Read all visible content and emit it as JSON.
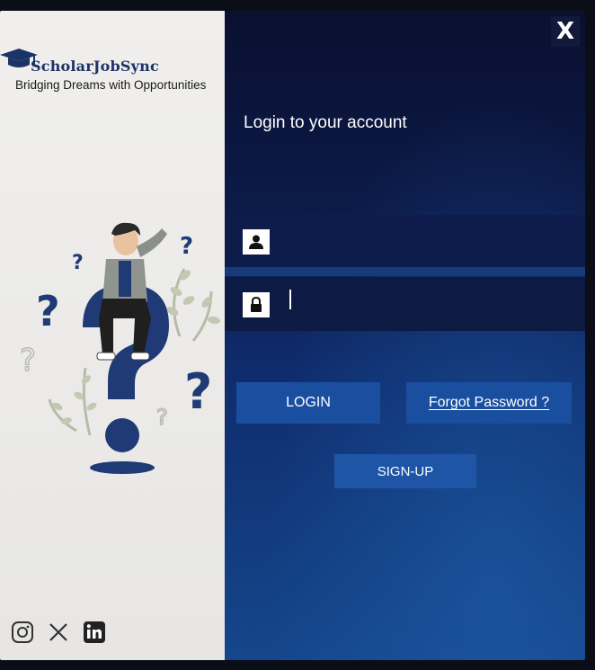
{
  "brand": {
    "name": "ScholarJobSync",
    "tagline": "Bridging Dreams with Opportunities"
  },
  "window": {
    "close_label": "X"
  },
  "login": {
    "title": "Login to your account",
    "username": {
      "value": "",
      "icon": "user-icon"
    },
    "password": {
      "value": "",
      "icon": "lock-icon"
    },
    "login_label": "LOGIN",
    "forgot_label": "Forgot Password ?",
    "signup_label": "SIGN-UP"
  },
  "social": [
    {
      "name": "instagram-icon"
    },
    {
      "name": "x-icon"
    },
    {
      "name": "linkedin-icon"
    }
  ],
  "colors": {
    "brand_blue": "#1b3468",
    "panel_dark": "#0a1030",
    "panel_light": "#15468c",
    "button_blue": "#1a4fa0"
  }
}
